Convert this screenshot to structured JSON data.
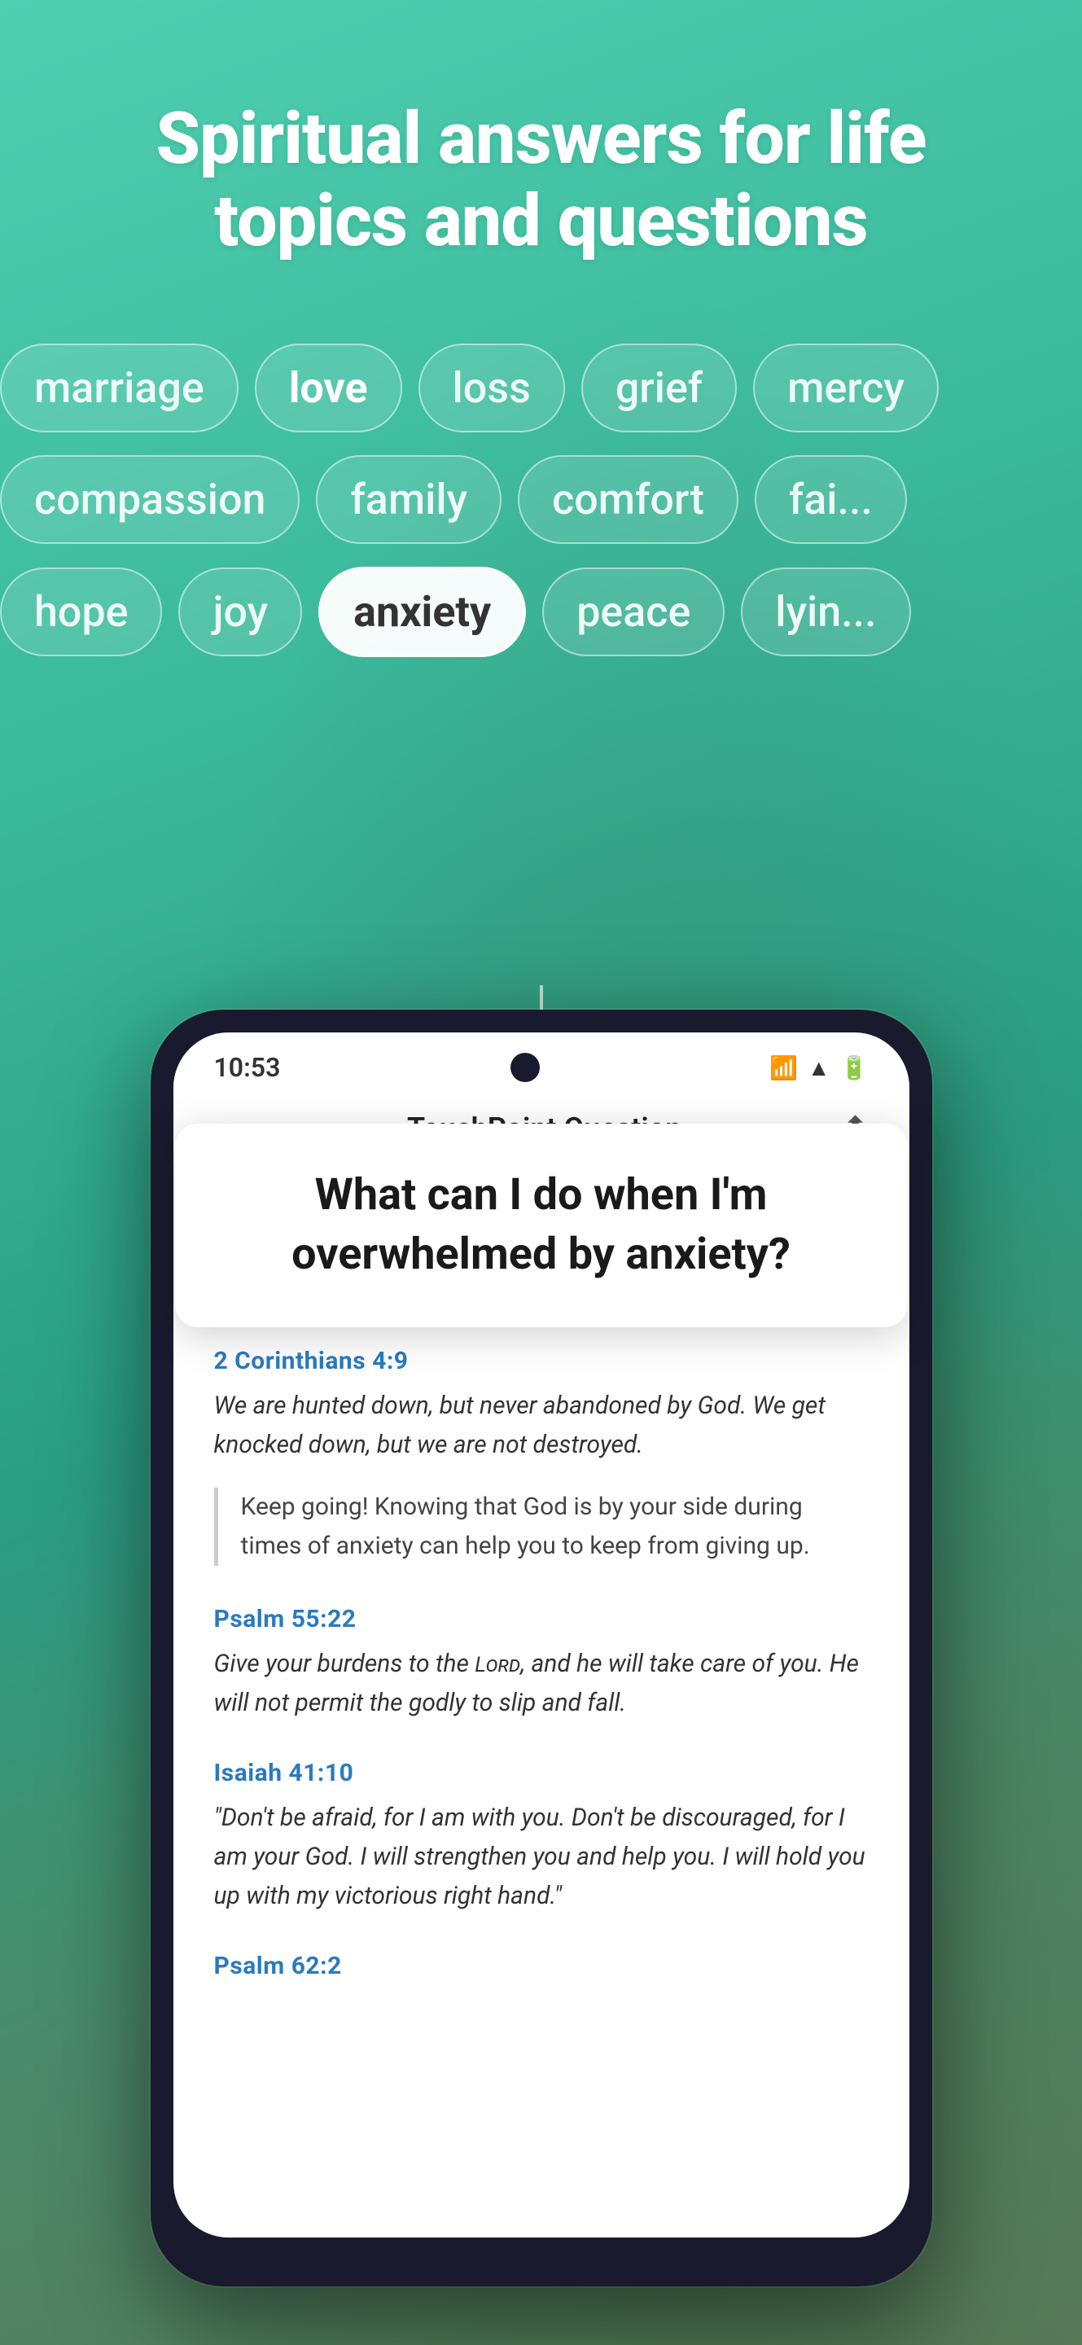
{
  "header": {
    "title_line1": "Spiritual answers for life",
    "title_line2": "topics and questions"
  },
  "tags": {
    "row1": [
      {
        "label": "marriage",
        "active": false,
        "bold": false
      },
      {
        "label": "love",
        "active": false,
        "bold": true
      },
      {
        "label": "loss",
        "active": false,
        "bold": false
      },
      {
        "label": "grief",
        "active": false,
        "bold": false
      },
      {
        "label": "mercy",
        "active": false,
        "bold": false
      }
    ],
    "row2": [
      {
        "label": "compassion",
        "active": false,
        "bold": false
      },
      {
        "label": "family",
        "active": false,
        "bold": false
      },
      {
        "label": "comfort",
        "active": false,
        "bold": false
      },
      {
        "label": "faith",
        "active": false,
        "bold": false
      }
    ],
    "row3": [
      {
        "label": "hope",
        "active": false,
        "bold": false
      },
      {
        "label": "joy",
        "active": false,
        "bold": false
      },
      {
        "label": "anxiety",
        "active": true,
        "bold": false
      },
      {
        "label": "peace",
        "active": false,
        "bold": false
      },
      {
        "label": "lying",
        "active": false,
        "bold": false
      }
    ]
  },
  "phone": {
    "status_time": "10:53",
    "nav_title": "TouchPoint Question",
    "question": "What can I do when I'm overwhelmed by anxiety?"
  },
  "scriptures": [
    {
      "ref": "2 Corinthians 4:9",
      "text": "We are hunted down, but never abandoned by God. We get knocked down, but we are not destroyed.",
      "comment": "Keep going! Knowing that God is by your side during times of anxiety can help you to keep from giving up."
    },
    {
      "ref": "Psalm 55:22",
      "text": "Give your burdens to the Lord, and he will take care of you. He will not permit the godly to slip and fall.",
      "comment": null
    },
    {
      "ref": "Isaiah 41:10",
      "text": "“Don’t be afraid, for I am with you. Don’t be discouraged, for I am your God. I will strengthen you and help you. I will hold you up with my victorious right hand.”",
      "comment": null
    },
    {
      "ref": "Psalm 62:2",
      "text": "",
      "comment": null
    }
  ],
  "icons": {
    "back_arrow": "←",
    "share": "↗"
  }
}
